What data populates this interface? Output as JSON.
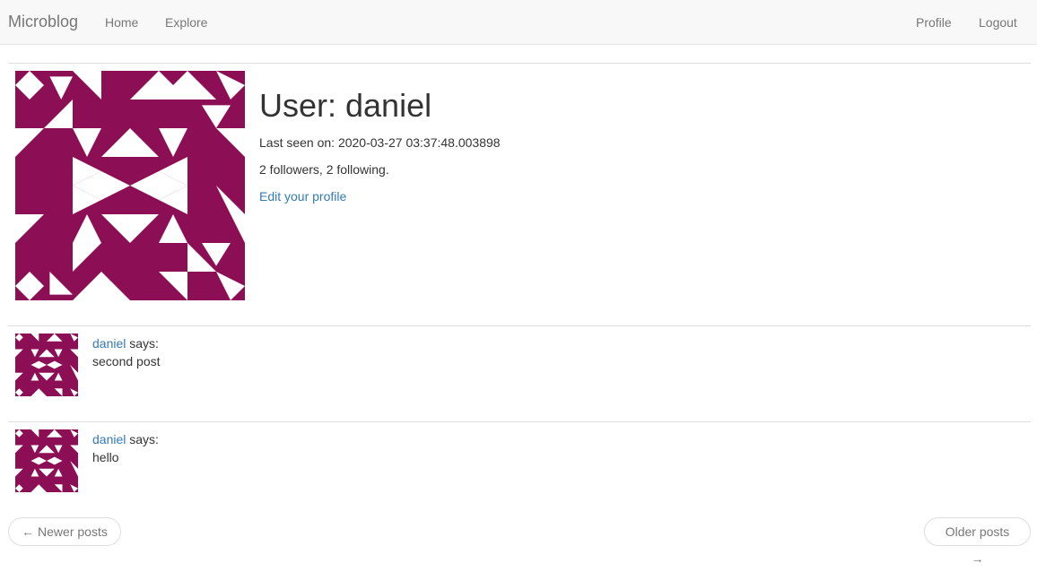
{
  "navbar": {
    "brand": "Microblog",
    "home": "Home",
    "explore": "Explore",
    "profile": "Profile",
    "logout": "Logout"
  },
  "profile": {
    "title": "User: daniel",
    "last_seen": "Last seen on: 2020-03-27 03:37:48.003898",
    "follow_stats": "2 followers, 2 following.",
    "edit_link": "Edit your profile"
  },
  "posts": [
    {
      "author": "daniel",
      "says": " says:",
      "body": "second post"
    },
    {
      "author": "daniel",
      "says": " says:",
      "body": "hello"
    }
  ],
  "pager": {
    "newer": "← Newer posts",
    "older": "Older posts →"
  },
  "colors": {
    "avatar": "#8c0f56",
    "link": "#337ab7"
  },
  "icons": {
    "avatar": "identicon-avatar"
  }
}
